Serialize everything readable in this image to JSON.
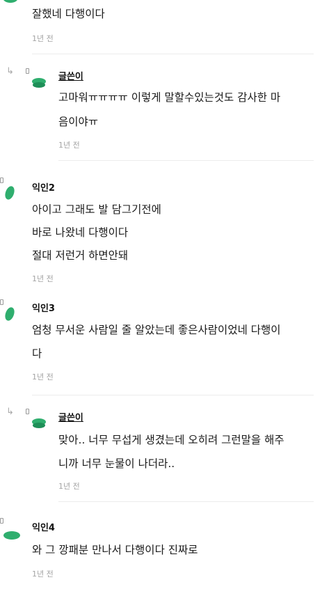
{
  "comments": [
    {
      "lines": [
        "잘했네 다행이다"
      ],
      "time": "1년 전"
    },
    {
      "author": "글쓴이",
      "lines": [
        "고마워ㅠㅠㅠㅠ 이렇게 말할수있는것도 감사한 마",
        "음이야ㅠ"
      ],
      "time": "1년 전"
    },
    {
      "author": "익인2",
      "lines": [
        "아이고 그래도 발 담그기전에",
        "바로 나왔네 다행이다",
        "절대 저런거 하면안돼"
      ],
      "time": "1년 전"
    },
    {
      "author": "익인3",
      "lines": [
        "엄청 무서운 사람일 줄 알았는데 좋은사람이었네 다행이",
        "다"
      ],
      "time": "1년 전"
    },
    {
      "author": "글쓴이",
      "lines": [
        "맞아.. 너무 무섭게 생겼는데 오히려 그런말을 해주",
        "니까 너무 눈물이 나더라.."
      ],
      "time": "1년 전"
    },
    {
      "author": "익인4",
      "lines": [
        "와 그 깡패분 만나서 다행이다 진짜로"
      ],
      "time": "1년 전"
    }
  ],
  "icons": {
    "reply": "reply-arrow-icon",
    "avatar": "green-blob-avatar-icon"
  },
  "colors": {
    "avatar_green": "#2fae6e",
    "avatar_green_dark": "#1f8f58",
    "time_gray": "#a4a4a4",
    "divider": "#ececec"
  }
}
